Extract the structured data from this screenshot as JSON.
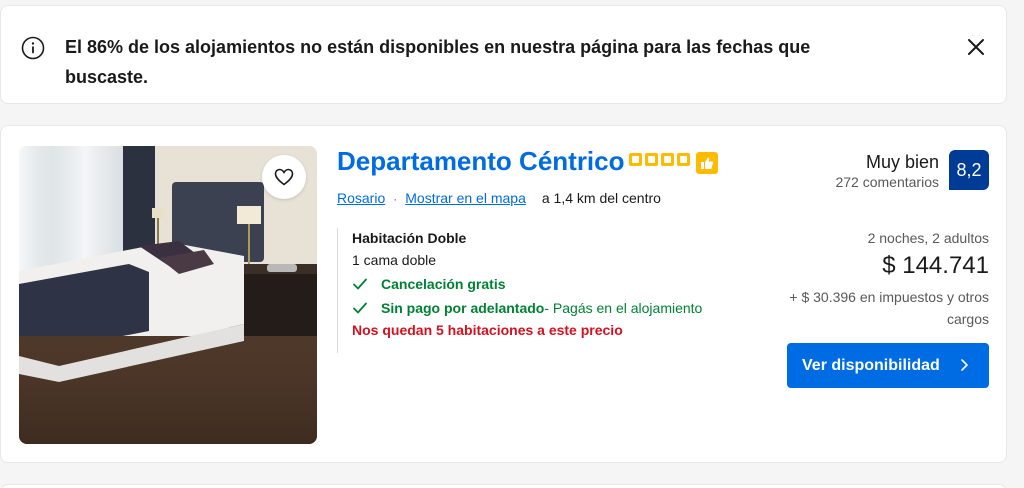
{
  "alert": {
    "message": "El 86% de los alojamientos no están disponibles en nuestra página para las fechas que buscaste.",
    "info_icon": "info-circle-icon",
    "close_icon": "close-icon"
  },
  "property": {
    "name": "Departamento Céntrico",
    "stars": 4,
    "badge_icon": "thumbs-up-icon",
    "city": "Rosario",
    "map_link": "Mostrar en el mapa",
    "distance": "a 1,4 km del centro",
    "rating_label": "Muy bien",
    "review_count": "272 comentarios",
    "score": "8,2",
    "room_type": "Habitación Doble",
    "bed": "1 cama doble",
    "perks": [
      {
        "main": "Cancelación gratis",
        "sub": ""
      },
      {
        "main": "Sin pago por adelantado",
        "sub": " - Pagás en el alojamiento"
      }
    ],
    "scarcity": "Nos quedan 5 habitaciones a este precio",
    "stay": "2 noches, 2 adultos",
    "price": "$ 144.741",
    "taxes": "+ $ 30.396 en impuestos y otros cargos",
    "cta": "Ver disponibilidad"
  },
  "colors": {
    "brand_blue": "#006ce4",
    "score_blue": "#003b95",
    "star_yellow": "#febb02",
    "green": "#008234",
    "red": "#d4111e"
  }
}
